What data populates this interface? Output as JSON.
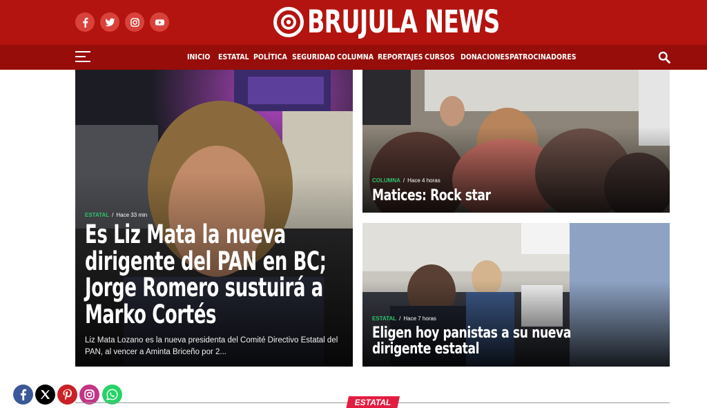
{
  "header": {
    "brand": "BRUJULA NEWS",
    "social": [
      {
        "name": "facebook-icon"
      },
      {
        "name": "twitter-icon"
      },
      {
        "name": "instagram-icon"
      },
      {
        "name": "youtube-icon"
      }
    ]
  },
  "nav": {
    "items": [
      {
        "label": "INICIO"
      },
      {
        "label": "ESTATAL"
      },
      {
        "label": "POLÍTICA"
      },
      {
        "label": "SEGURIDAD"
      },
      {
        "label": "COLUMNA"
      },
      {
        "label": "REPORTAJES"
      },
      {
        "label": "CURSOS"
      },
      {
        "label": "DONACIONES"
      },
      {
        "label": "PATROCINADORES"
      }
    ],
    "menu_icon": "hamburger-menu-icon",
    "search_icon": "search-icon"
  },
  "featured": {
    "category": "ESTATAL",
    "time": "Hace 33 min",
    "title_lines": [
      "Es Liz Mata la nueva",
      "dirigente del PAN en BC;",
      "Jorge Romero sustuirá a",
      "Marko Cortés"
    ],
    "excerpt": "Liz Mata Lozano es la nueva presidenta del Comité Directivo Estatal del PAN, al vencer a Aminta Briceño por 2..."
  },
  "story_top": {
    "category": "COLUMNA",
    "time": "Hace 4 horas",
    "title": "Matices: Rock star"
  },
  "story_bottom": {
    "category": "ESTATAL",
    "time": "Hace 7 horas",
    "title_lines": [
      "Eligen hoy panistas a su nueva",
      "dirigente estatal"
    ]
  },
  "share_bar": [
    {
      "name": "facebook-share-icon",
      "color": "#3b5998"
    },
    {
      "name": "x-share-icon",
      "color": "#000000"
    },
    {
      "name": "pinterest-share-icon",
      "color": "#cb2027"
    },
    {
      "name": "instagram-share-icon",
      "color": "#c13584"
    },
    {
      "name": "whatsapp-share-icon",
      "color": "#25d366"
    }
  ],
  "section": {
    "label": "ESTATAL"
  },
  "colors": {
    "brand_red": "#b3140f",
    "nav_red": "#970d0a",
    "category_green": "#2fc26a",
    "section_pink": "#e31d42"
  }
}
